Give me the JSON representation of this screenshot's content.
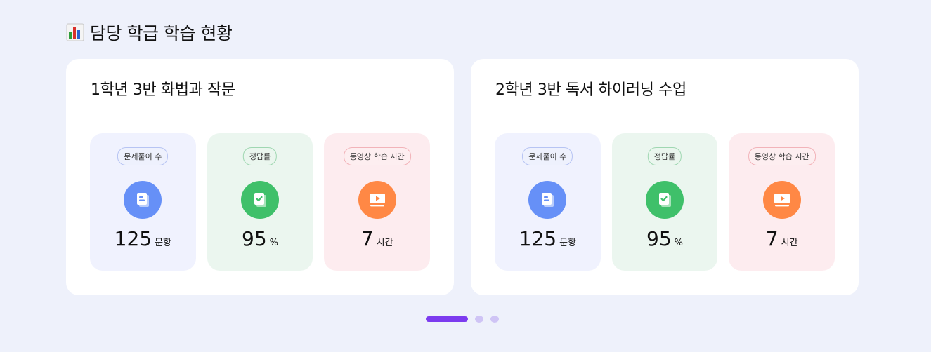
{
  "section": {
    "title": "담당 학급 학습 현황",
    "icon": "bar-chart-icon"
  },
  "classes": [
    {
      "title": "1학년 3반 화법과 작문",
      "stats": [
        {
          "label": "문제풀이 수",
          "value": "125",
          "unit": "문항",
          "icon": "document-icon",
          "color": "#6690f7"
        },
        {
          "label": "정답률",
          "value": "95",
          "unit": "%",
          "icon": "check-document-icon",
          "color": "#3fc06a"
        },
        {
          "label": "동영상 학습 시간",
          "value": "7",
          "unit": "시간",
          "icon": "video-play-icon",
          "color": "#ff8845"
        }
      ]
    },
    {
      "title": "2학년 3반 독서 하이러닝 수업",
      "stats": [
        {
          "label": "문제풀이 수",
          "value": "125",
          "unit": "문항",
          "icon": "document-icon",
          "color": "#6690f7"
        },
        {
          "label": "정답률",
          "value": "95",
          "unit": "%",
          "icon": "check-document-icon",
          "color": "#3fc06a"
        },
        {
          "label": "동영상 학습 시간",
          "value": "7",
          "unit": "시간",
          "icon": "video-play-icon",
          "color": "#ff8845"
        }
      ]
    }
  ],
  "pagination": {
    "total_pages": 3,
    "current_page": 1,
    "active_color": "#7c3bef",
    "inactive_color": "#cfc4f5"
  }
}
